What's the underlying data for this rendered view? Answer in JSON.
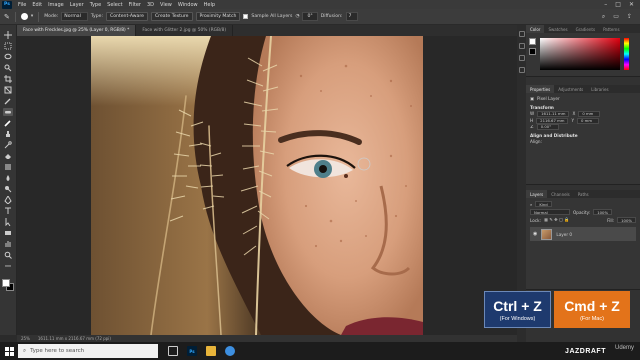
{
  "app": {
    "logo": "Ps"
  },
  "menu": [
    "File",
    "Edit",
    "Image",
    "Layer",
    "Type",
    "Select",
    "Filter",
    "3D",
    "View",
    "Window",
    "Help"
  ],
  "options": {
    "mode_label": "Mode:",
    "mode_value": "Normal",
    "type_label": "Type:",
    "type_buttons": [
      "Content-Aware",
      "Create Texture",
      "Proximity Match"
    ],
    "sample_all_layers": "Sample All Layers",
    "diffusion_label": "Diffusion:",
    "diffusion_value": "7"
  },
  "tabs": [
    {
      "label": "Face with Freckles.jpg @ 25% (Layer 0, RGB/8) *",
      "active": true
    },
    {
      "label": "Face with Glitter 2.jpg @ 50% (RGB/8)",
      "active": false
    }
  ],
  "tools": [
    "move-icon",
    "marquee-icon",
    "lasso-icon",
    "quick-select-icon",
    "crop-icon",
    "frame-icon",
    "eyedropper-icon",
    "spot-healing-icon",
    "brush-icon",
    "clone-stamp-icon",
    "history-brush-icon",
    "eraser-icon",
    "gradient-icon",
    "blur-icon",
    "dodge-icon",
    "pen-icon",
    "type-icon",
    "path-select-icon",
    "rectangle-icon",
    "hand-icon",
    "zoom-icon",
    "more-icon"
  ],
  "status": {
    "zoom": "25%",
    "doc": "1611.11 mm x 2116.67 mm (72 ppi)"
  },
  "panels": {
    "color_tabs": [
      "Color",
      "Swatches",
      "Gradients",
      "Patterns"
    ],
    "props_tabs": [
      "Properties",
      "Adjustments",
      "Libraries"
    ],
    "pixel_layer": "Pixel Layer",
    "transform": "Transform",
    "w_value": "1611.11 mm",
    "h_value": "2116.67 mm",
    "x_value": "0 mm",
    "y_value": "0 mm",
    "angle_value": "0.00°",
    "align": "Align and Distribute",
    "align_sub": "Align:",
    "layers_tabs": [
      "Layers",
      "Channels",
      "Paths"
    ],
    "kind": "Kind",
    "blend": "Normal",
    "opacity_label": "Opacity:",
    "opacity_value": "100%",
    "lock_label": "Lock:",
    "fill_label": "Fill:",
    "fill_value": "100%",
    "layer_name": "Layer 0"
  },
  "badges": {
    "win_keys": "Ctrl + Z",
    "win_sub": "(For Windows)",
    "mac_keys": "Cmd + Z",
    "mac_sub": "(For Mac)"
  },
  "taskbar": {
    "search": "Type here to search",
    "brand": "JAZDRAFT",
    "watermark": "Udemy"
  }
}
